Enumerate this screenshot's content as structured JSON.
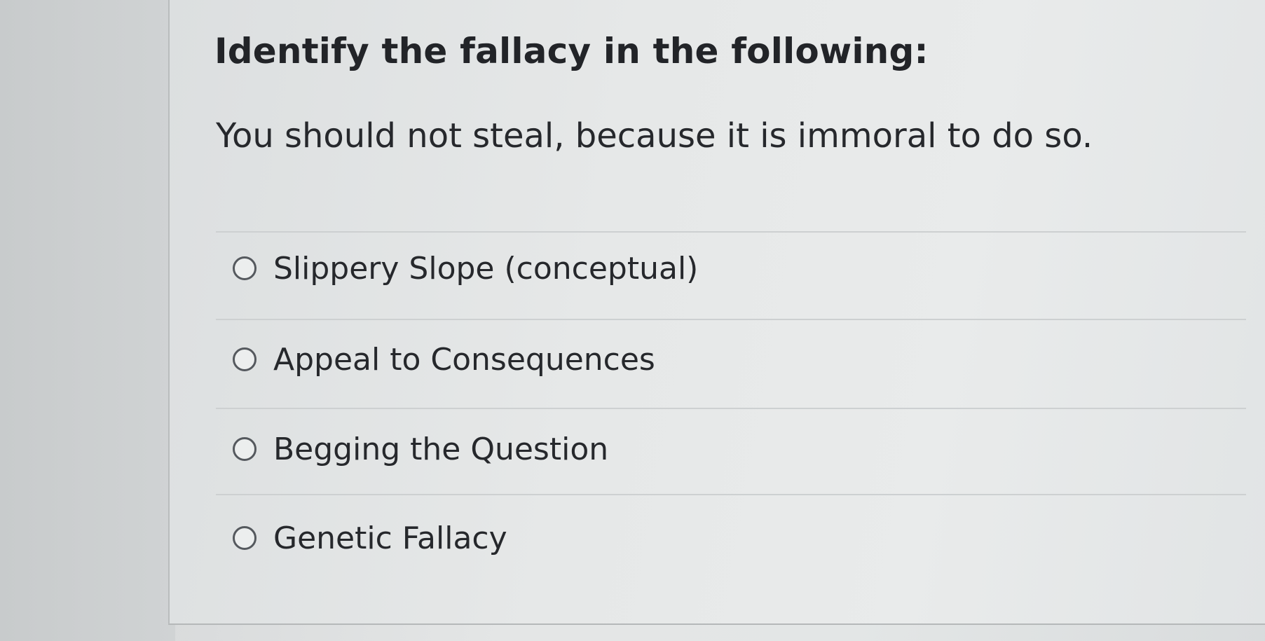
{
  "question": {
    "title": "Identify the fallacy in the following:",
    "text": "You should not steal, because it is immoral to do so."
  },
  "options": [
    {
      "label": "Slippery Slope (conceptual)",
      "selected": false
    },
    {
      "label": "Appeal to Consequences",
      "selected": false
    },
    {
      "label": "Begging the Question",
      "selected": false
    },
    {
      "label": "Genetic Fallacy",
      "selected": false
    }
  ]
}
